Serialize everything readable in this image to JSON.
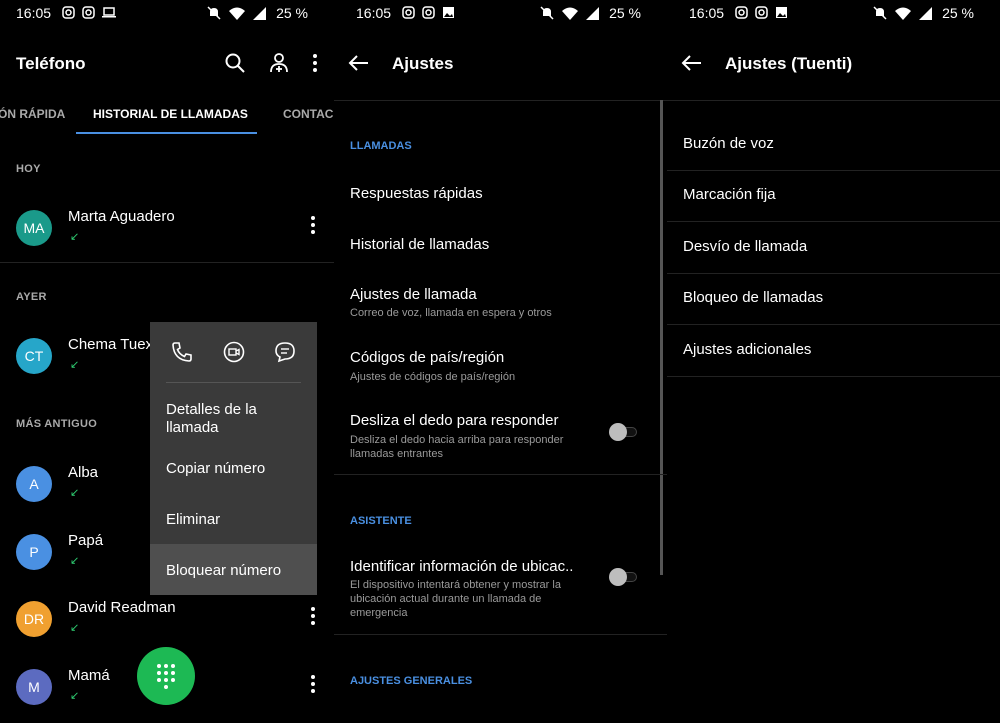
{
  "status": {
    "time": "16:05",
    "battery": "25 %"
  },
  "screen1": {
    "title": "Teléfono",
    "tabs": [
      "ÓN RÁPIDA",
      "HISTORIAL DE LLAMADAS",
      "CONTAC"
    ],
    "sections": {
      "today": "HOY",
      "yesterday": "AYER",
      "older": "MÁS ANTIGUO"
    },
    "calls": [
      {
        "initials": "MA",
        "name": "Marta Aguadero",
        "color": "#1a9a8a"
      },
      {
        "initials": "CT",
        "name": "Chema Tuex",
        "color": "#26a6c9"
      },
      {
        "initials": "A",
        "name": "Alba",
        "color": "#4a90e2"
      },
      {
        "initials": "P",
        "name": "Papá",
        "color": "#4a90e2"
      },
      {
        "initials": "DR",
        "name": "David Readman",
        "color": "#f0a030"
      },
      {
        "initials": "M",
        "name": "Mamá",
        "color": "#5c6bc0"
      }
    ],
    "arrow": "↙",
    "popup": {
      "items": [
        "Detalles de la llamada",
        "Copiar número",
        "Eliminar",
        "Bloquear número"
      ]
    }
  },
  "screen2": {
    "title": "Ajustes",
    "cat_calls": "LLAMADAS",
    "cat_assistant": "ASISTENTE",
    "cat_general": "AJUSTES GENERALES",
    "items": [
      {
        "title": "Respuestas rápidas"
      },
      {
        "title": "Historial de llamadas"
      },
      {
        "title": "Ajustes de llamada",
        "subtitle": "Correo de voz, llamada en espera y otros"
      },
      {
        "title": "Códigos de país/región",
        "subtitle": "Ajustes de códigos de país/región"
      },
      {
        "title": "Desliza el dedo para responder",
        "subtitle": "Desliza el dedo hacia arriba para responder llamadas entrantes"
      },
      {
        "title": "Identificar información de ubicac..",
        "subtitle": "El dispositivo intentará obtener y mostrar la ubicación actual durante un llamada de emergencia"
      }
    ]
  },
  "screen3": {
    "title": "Ajustes (Tuenti)",
    "items": [
      "Buzón de voz",
      "Marcación fija",
      "Desvío de llamada",
      "Bloqueo de llamadas",
      "Ajustes adicionales"
    ]
  }
}
